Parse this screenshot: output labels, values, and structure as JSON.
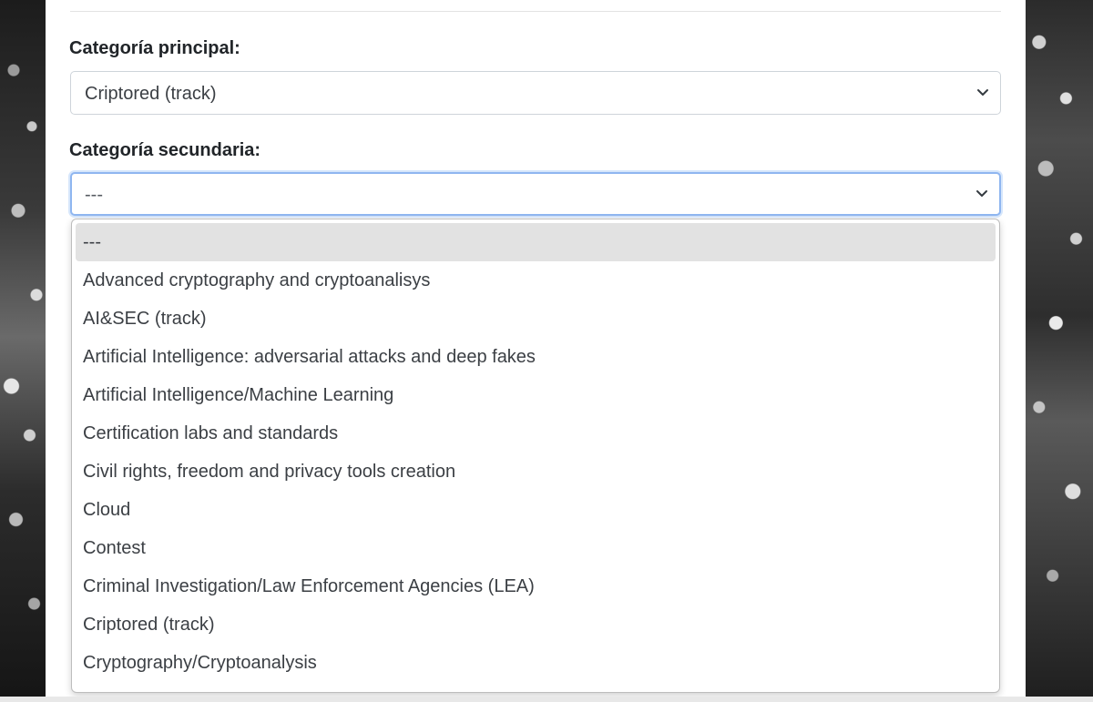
{
  "form": {
    "primary_label": "Categoría principal:",
    "primary_value": "Criptored (track)",
    "secondary_label": "Categoría secundaria:",
    "secondary_value": "---"
  },
  "dropdown": {
    "selected_index": 0,
    "options": [
      "---",
      "Advanced cryptography and cryptoanalisys",
      "AI&SEC (track)",
      "Artificial Intelligence: adversarial attacks and deep fakes",
      "Artificial Intelligence/Machine Learning",
      "Certification labs and standards",
      "Civil rights, freedom and privacy tools creation",
      "Cloud",
      "Contest",
      "Criminal Investigation/Law Enforcement Agencies (LEA)",
      "Criptored (track)",
      "Cryptography/Cryptoanalysis"
    ]
  },
  "icons": {
    "select_chevron": "chevron-down-icon"
  },
  "colors": {
    "focus_border": "#8fb6f0",
    "selected_option_bg": "#e2e2e2",
    "text": "#3b3f44"
  }
}
